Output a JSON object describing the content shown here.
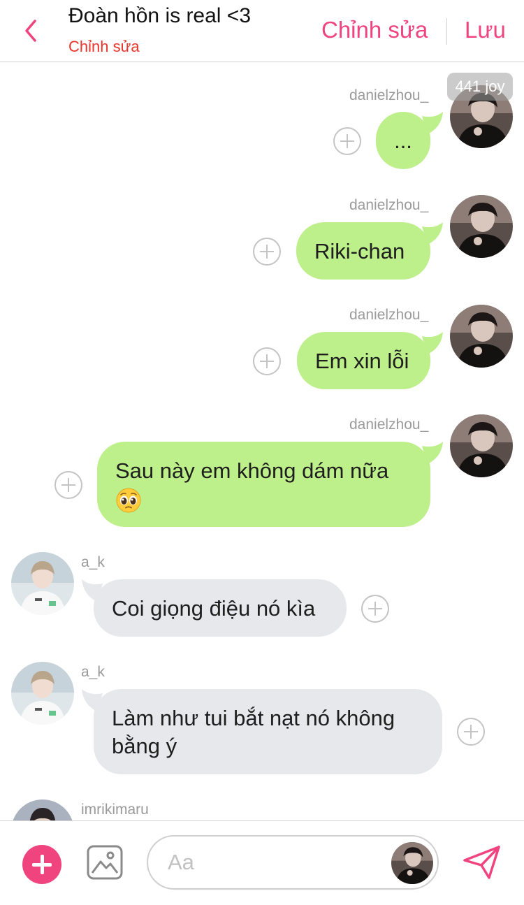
{
  "header": {
    "title": "Đoàn hồn is real <3",
    "subtitle": "Chỉnh sửa",
    "edit_label": "Chỉnh sửa",
    "save_label": "Lưu",
    "back_icon": "chevron-left-icon"
  },
  "badge": {
    "text": "441 joy"
  },
  "messages": [
    {
      "sender": "danielzhou_",
      "direction": "outgoing",
      "text": "...",
      "emoji": ""
    },
    {
      "sender": "danielzhou_",
      "direction": "outgoing",
      "text": "Riki-chan",
      "emoji": ""
    },
    {
      "sender": "danielzhou_",
      "direction": "outgoing",
      "text": "Em xin lỗi",
      "emoji": ""
    },
    {
      "sender": "danielzhou_",
      "direction": "outgoing",
      "text": "Sau này em không dám nữa",
      "emoji": "pleading-face"
    },
    {
      "sender": "a_k",
      "direction": "incoming",
      "text": "Coi giọng điệu nó kìa",
      "emoji": ""
    },
    {
      "sender": "a_k",
      "direction": "incoming",
      "text": "Làm như tui bắt nạt nó không bằng ý",
      "emoji": ""
    },
    {
      "sender": "imrikimaru",
      "direction": "incoming",
      "text": "",
      "emoji": ""
    }
  ],
  "composer": {
    "placeholder": "Aa",
    "add_icon": "plus-circle-icon",
    "image_icon": "image-icon",
    "send_icon": "send-icon"
  },
  "colors": {
    "accent": "#f0447f",
    "subtitle": "#e9352b",
    "outgoing_bubble": "#bdf08a",
    "incoming_bubble": "#e6e8ec"
  }
}
